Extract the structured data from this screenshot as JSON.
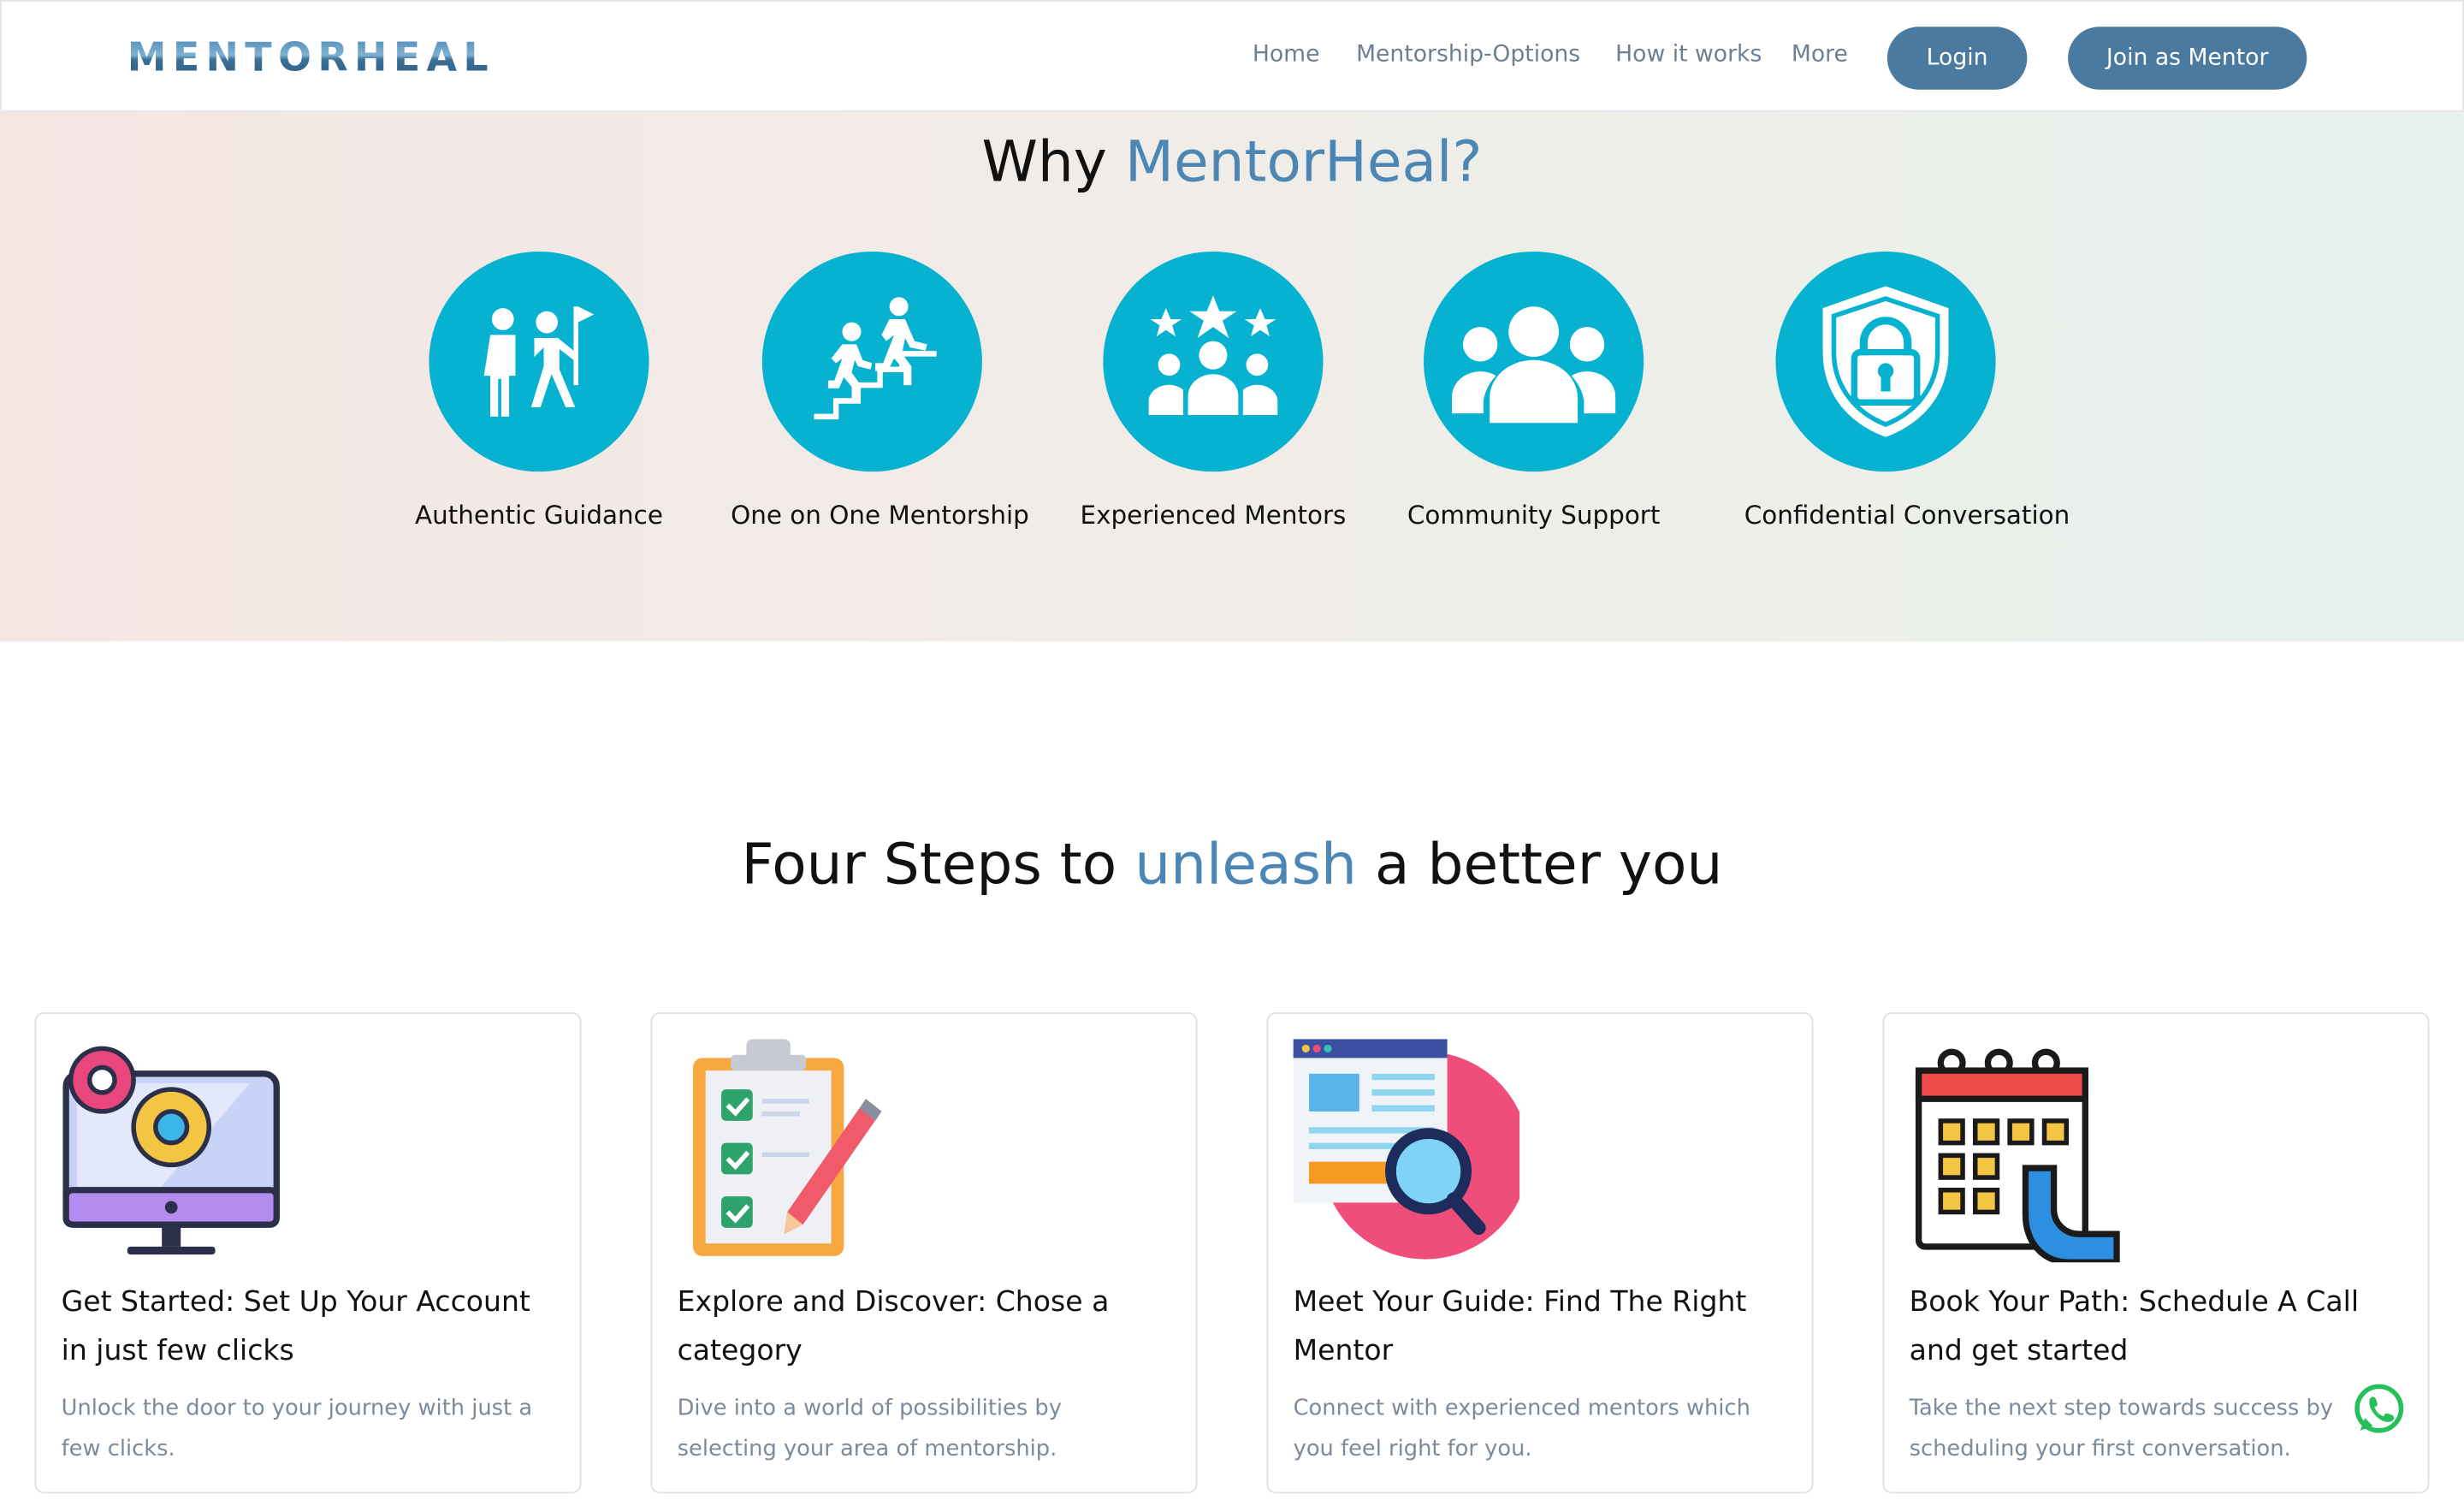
{
  "brand": {
    "logo_text": "MENTORHEAL"
  },
  "nav": {
    "links": [
      "Home",
      "Mentorship-Options",
      "How it works",
      "More"
    ],
    "login_label": "Login",
    "join_label": "Join as Mentor"
  },
  "why": {
    "title_pre": "Why ",
    "title_accent": "MentorHeal?",
    "features": [
      {
        "label": "Authentic Guidance",
        "icon": "guidance-icon"
      },
      {
        "label": "One on One Mentorship",
        "icon": "stairs-climb-icon"
      },
      {
        "label": "Experienced Mentors",
        "icon": "star-team-icon"
      },
      {
        "label": "Community Support",
        "icon": "community-icon"
      },
      {
        "label": "Confidential Conversation",
        "icon": "shield-lock-icon"
      }
    ]
  },
  "steps": {
    "title_pre": "Four Steps to ",
    "title_accent": "unleash",
    "title_post": " a better you",
    "cards": [
      {
        "title": "Get Started: Set Up Your Account in just few clicks",
        "text": "Unlock the door to your journey with just a few clicks.",
        "icon": "monitor-gears-icon"
      },
      {
        "title": "Explore and Discover: Chose a category",
        "text": "Dive into a world of possibilities by selecting your area of mentorship.",
        "icon": "clipboard-checklist-icon"
      },
      {
        "title": "Meet Your Guide: Find The Right Mentor",
        "text": "Connect with experienced mentors which you feel right for you.",
        "icon": "search-page-icon"
      },
      {
        "title": "Book Your Path: Schedule A Call and get started",
        "text": "Take the next step towards success by scheduling your first conversation.",
        "icon": "calendar-phone-icon"
      }
    ]
  },
  "colors": {
    "accent": "#4b86b4",
    "button": "#4a7a9f",
    "feature_circle": "#06b2cf"
  }
}
